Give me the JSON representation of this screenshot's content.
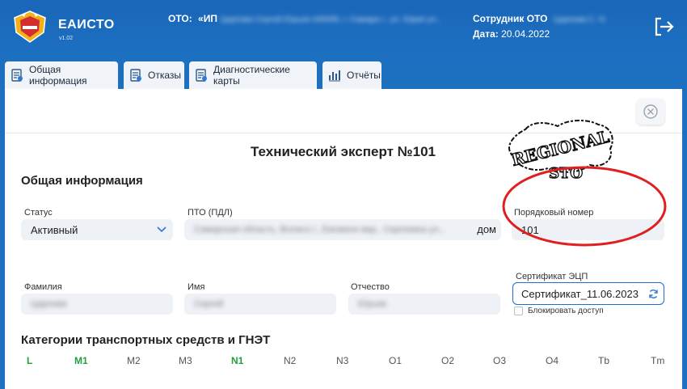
{
  "header": {
    "app_name": "ЕАИСТО",
    "app_version": "v1.02",
    "oto_label": "ОТО:",
    "oto_value": "«ИП",
    "oto_value_hidden": "Царпова Сергей Юрьев 445695, г. Самара г., ул. Юрия ул.,",
    "employee_label": "Сотрудник ОТО",
    "employee_value_hidden": "Царпова С. Н.",
    "date_label": "Дата:",
    "date_value": "20.04.2022"
  },
  "tabs": [
    {
      "label": "Общая информация"
    },
    {
      "label": "Отказы"
    },
    {
      "label": "Диагностические карты"
    },
    {
      "label": "Отчёты"
    }
  ],
  "page": {
    "title": "Технический эксперт №101",
    "section_general": "Общая информация",
    "section_categories": "Категории транспортных средств и ГНЭТ"
  },
  "fields": {
    "status_label": "Статус",
    "status_value": "Активный",
    "pto_label": "ПТО (ПДЛ)",
    "pto_value_hidden": "Самарская область, Волжск г., Ежовини мкр., Сергеевка ул.,",
    "pto_value_visible": "дом",
    "order_label": "Порядковый номер",
    "order_value": "101",
    "surname_label": "Фамилия",
    "surname_value_hidden": "Царпова",
    "name_label": "Имя",
    "name_value_hidden": "Сергей",
    "patronymic_label": "Отчество",
    "patronymic_value_hidden": "Юрьев",
    "cert_label": "Сертификат ЭЦП",
    "cert_value": "Сертификат_11.06.2023",
    "block_access_label": "Блокировать доступ"
  },
  "categories": [
    {
      "code": "L",
      "active": true
    },
    {
      "code": "M1",
      "active": true
    },
    {
      "code": "M2",
      "active": false
    },
    {
      "code": "M3",
      "active": false
    },
    {
      "code": "N1",
      "active": true
    },
    {
      "code": "N2",
      "active": false
    },
    {
      "code": "N3",
      "active": false
    },
    {
      "code": "O1",
      "active": false
    },
    {
      "code": "O2",
      "active": false
    },
    {
      "code": "O3",
      "active": false
    },
    {
      "code": "O4",
      "active": false
    },
    {
      "code": "Tb",
      "active": false
    },
    {
      "code": "Tm",
      "active": false
    }
  ],
  "watermark": {
    "line1": "REGIONAL",
    "line2": "STO"
  },
  "colors": {
    "header_bg": "#1d70c2",
    "accent": "#1d70c2",
    "active_category": "#22a040",
    "annotation": "#e02020"
  }
}
